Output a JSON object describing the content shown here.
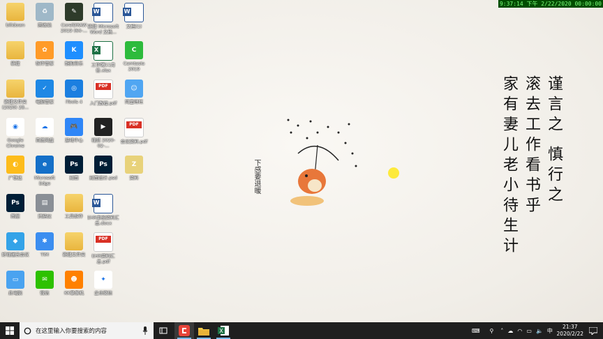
{
  "overlay_clock": "9:37:14 下午 2/22/2020 00:00:00",
  "desktop_icons": [
    {
      "id": "bilidown",
      "label": "bilidown",
      "kind": "folder",
      "col": 0,
      "row": 0
    },
    {
      "id": "recycle",
      "label": "回收站",
      "kind": "recycle",
      "col": 1,
      "row": 0
    },
    {
      "id": "coreldraw",
      "label": "CorelDRAW 2019 (64-...",
      "kind": "corel",
      "col": 2,
      "row": 0
    },
    {
      "id": "doc1",
      "label": "新建 Microsoft Word 文档...",
      "kind": "word",
      "col": 3,
      "row": 0
    },
    {
      "id": "doc2",
      "label": "文档(1)",
      "kind": "word",
      "col": 4,
      "row": 0
    },
    {
      "id": "newfolder",
      "label": "新建",
      "kind": "folder",
      "col": 0,
      "row": 1
    },
    {
      "id": "appstore",
      "label": "软件管家",
      "kind": "store",
      "col": 1,
      "row": 1
    },
    {
      "id": "kugou",
      "label": "酷狗音乐",
      "kind": "kugou",
      "col": 2,
      "row": 1
    },
    {
      "id": "xlsx1",
      "label": "工作簿11月份.xlsx",
      "kind": "excel",
      "col": 3,
      "row": 1
    },
    {
      "id": "camtasia",
      "label": "Camtasia 2019",
      "kind": "camtasia",
      "col": 4,
      "row": 1
    },
    {
      "id": "folder2",
      "label": "新建文件夹 (2020) 28...",
      "kind": "folder",
      "col": 0,
      "row": 2
    },
    {
      "id": "pcmgr",
      "label": "电脑管家",
      "kind": "shield",
      "col": 1,
      "row": 2
    },
    {
      "id": "itools",
      "label": "iTools 4",
      "kind": "itools",
      "col": 2,
      "row": 2
    },
    {
      "id": "pdf1",
      "label": "入门教程.pdf",
      "kind": "pdf",
      "col": 3,
      "row": 2
    },
    {
      "id": "qqbrowser",
      "label": "阿里旺旺",
      "kind": "wangwang",
      "col": 4,
      "row": 2
    },
    {
      "id": "chrome",
      "label": "Google Chrome",
      "kind": "chrome",
      "col": 0,
      "row": 3
    },
    {
      "id": "baidunet",
      "label": "百度网盘",
      "kind": "baidu",
      "col": 1,
      "row": 3
    },
    {
      "id": "game",
      "label": "游戏中心",
      "kind": "gamepad",
      "col": 2,
      "row": 3
    },
    {
      "id": "video",
      "label": "视频 2020-02-...",
      "kind": "video",
      "col": 3,
      "row": 3
    },
    {
      "id": "pdf2",
      "label": "会议资料.pdf",
      "kind": "pdf",
      "col": 4,
      "row": 3
    },
    {
      "id": "guangjia",
      "label": "广联达",
      "kind": "gld",
      "col": 0,
      "row": 4
    },
    {
      "id": "edge",
      "label": "Microsoft Edge",
      "kind": "edge",
      "col": 1,
      "row": 4
    },
    {
      "id": "ps1",
      "label": "封面",
      "kind": "ps",
      "col": 2,
      "row": 4
    },
    {
      "id": "ps2",
      "label": "封面设计.psd",
      "kind": "ps",
      "col": 3,
      "row": 4
    },
    {
      "id": "zip1",
      "label": "资料",
      "kind": "zip",
      "col": 4,
      "row": 4
    },
    {
      "id": "ps3",
      "label": "图层",
      "kind": "ps",
      "col": 0,
      "row": 5
    },
    {
      "id": "scanner",
      "label": "扫描仪",
      "kind": "scanner",
      "col": 1,
      "row": 5
    },
    {
      "id": "folder3",
      "label": "工具软件",
      "kind": "folder",
      "col": 2,
      "row": 5
    },
    {
      "id": "doc3",
      "label": "EHR系统资料汇总.docx",
      "kind": "word",
      "col": 3,
      "row": 5
    },
    {
      "id": "colorful",
      "label": "好视通云会议",
      "kind": "cube",
      "col": 0,
      "row": 6
    },
    {
      "id": "tim",
      "label": "TIM",
      "kind": "tim",
      "col": 1,
      "row": 6
    },
    {
      "id": "folder4",
      "label": "新建文件夹",
      "kind": "folder",
      "col": 2,
      "row": 6
    },
    {
      "id": "pdf3",
      "label": "EHR资料汇总.pdf",
      "kind": "pdf",
      "col": 3,
      "row": 6
    },
    {
      "id": "thispc",
      "label": "此电脑",
      "kind": "pc",
      "col": 0,
      "row": 7
    },
    {
      "id": "wechat",
      "label": "微信",
      "kind": "wechat",
      "col": 1,
      "row": 7
    },
    {
      "id": "kk",
      "label": "KK录像机",
      "kind": "kk",
      "col": 2,
      "row": 7
    },
    {
      "id": "qywx",
      "label": "企业微信",
      "kind": "qywx",
      "col": 3,
      "row": 7
    }
  ],
  "poem_columns": [
    "谨言之 慎行之",
    "滚去工作看书乎",
    "家有妻儿老小待生计"
  ],
  "taskbar": {
    "search_placeholder": "在这里输入你要搜索的内容",
    "time": "21:37",
    "date": "2020/2/22",
    "ime": "中",
    "pinned": [
      "task-view",
      "camtasia",
      "file-explorer",
      "excel"
    ]
  }
}
